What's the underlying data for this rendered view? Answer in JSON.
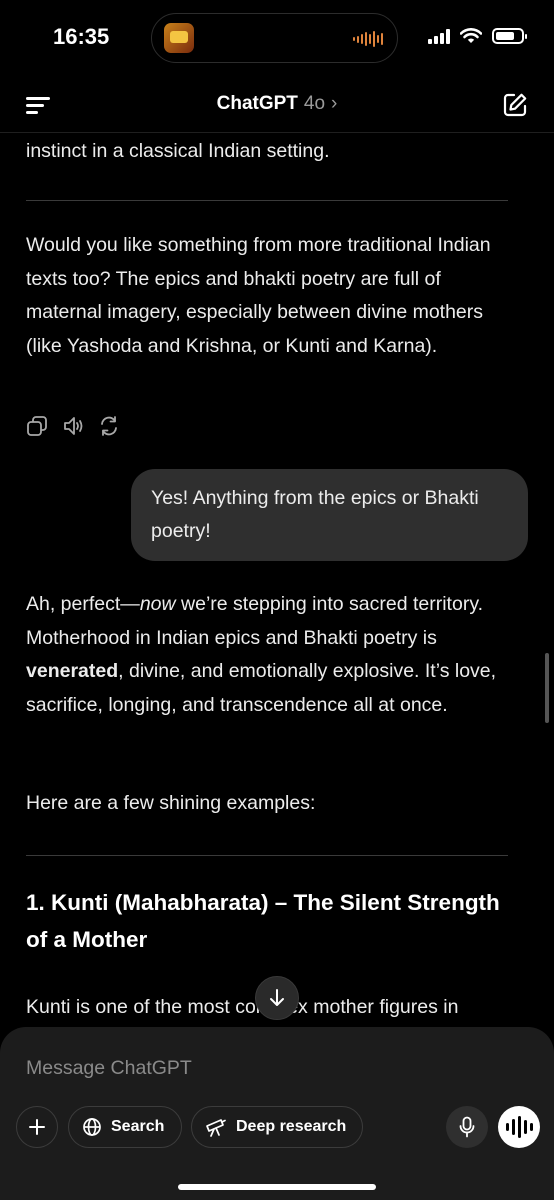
{
  "status_bar": {
    "time": "16:35"
  },
  "nav": {
    "title": "ChatGPT",
    "model": "4o",
    "chevron": "›"
  },
  "chat": {
    "prev_tail": "instinct in a classical Indian setting.",
    "assistant_followup": "Would you like something from more traditional Indian texts too? The epics and bhakti poetry are full of maternal imagery, especially between divine mothers (like Yashoda and Krishna, or Kunti and Karna).",
    "user_message": "Yes! Anything from the epics or Bhakti poetry!",
    "reply": {
      "p1_a": "Ah, perfect—",
      "p1_em": "now",
      "p1_b": " we’re stepping into sacred territory. Motherhood in Indian epics and Bhakti poetry is ",
      "p1_strong": "venerated",
      "p1_c": ", divine, and emotionally explosive. It’s love, sacrifice, longing, and transcendence all at once.",
      "p2": "Here are a few shining examples:",
      "heading": "1. Kunti (Mahabharata) – The Silent Strength of a Mother",
      "p3": "Kunti is one of the most complex mother figures in"
    }
  },
  "composer": {
    "placeholder": "Message ChatGPT",
    "search_label": "Search",
    "deep_research_label": "Deep research"
  },
  "icons": {
    "menu": "menu-icon",
    "new_chat": "new-chat-icon",
    "copy": "copy-icon",
    "read_aloud": "speaker-icon",
    "regenerate": "regenerate-icon",
    "scroll_down": "arrow-down-icon",
    "plus": "plus-icon",
    "search": "globe-icon",
    "deep_research": "telescope-icon",
    "mic": "microphone-icon",
    "voice": "voice-waveform-icon"
  },
  "colors": {
    "background": "#000000",
    "bubble": "#2f2f2f",
    "composer": "#1c1c1c",
    "text": "#ececec",
    "muted": "#9a9a9a"
  }
}
